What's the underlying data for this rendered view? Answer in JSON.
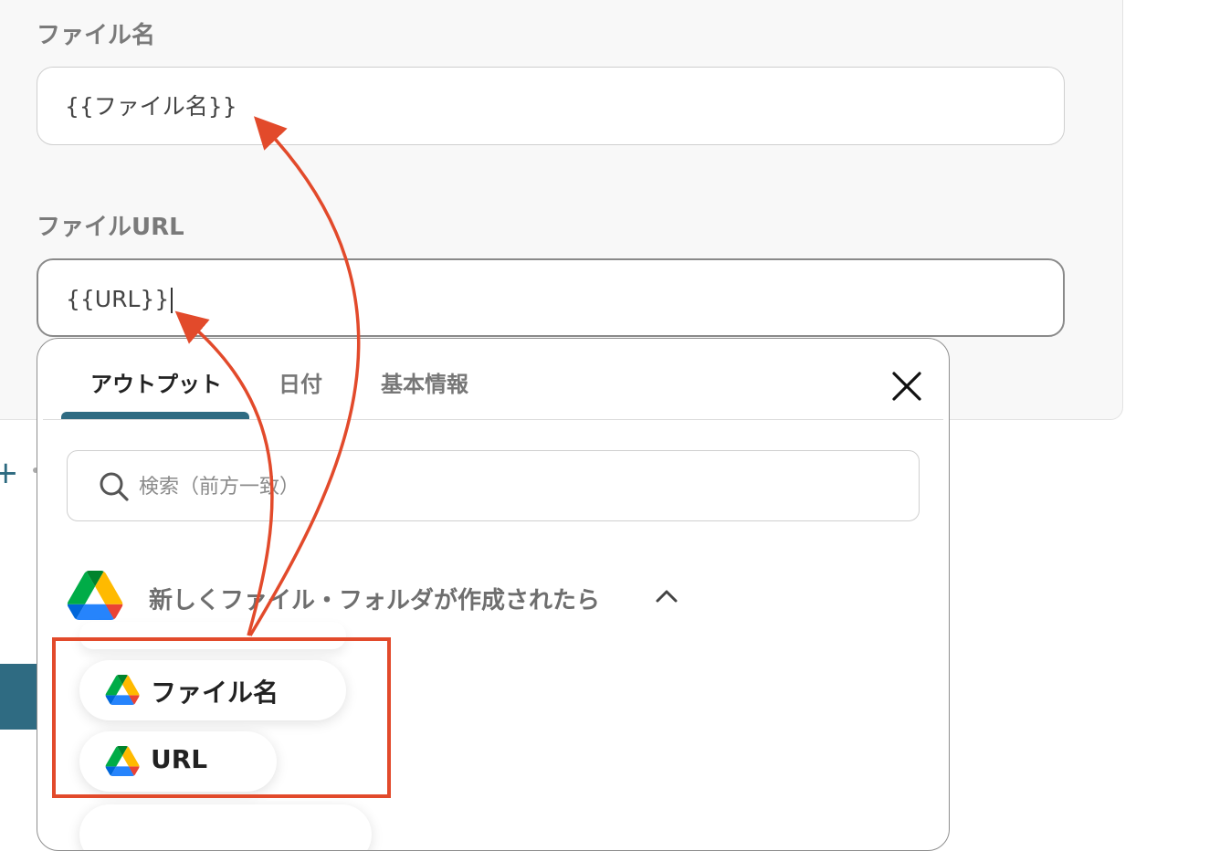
{
  "form": {
    "file_name_label": "ファイル名",
    "file_name_value": "{{ファイル名}}",
    "file_url_label": "ファイルURL",
    "file_url_value": "{{URL}}"
  },
  "dropdown": {
    "tabs": [
      {
        "label": "アウトプット",
        "active": true
      },
      {
        "label": "日付",
        "active": false
      },
      {
        "label": "基本情報",
        "active": false
      }
    ],
    "search_placeholder": "検索（前方一致）",
    "group_title": "新しくファイル・フォルダが作成されたら",
    "items": [
      {
        "label": "ファイル名",
        "icon": "google-drive-icon"
      },
      {
        "label": "URL",
        "icon": "google-drive-icon"
      }
    ]
  },
  "colors": {
    "accent": "#2f6b82",
    "annotation": "#e24a2b"
  }
}
